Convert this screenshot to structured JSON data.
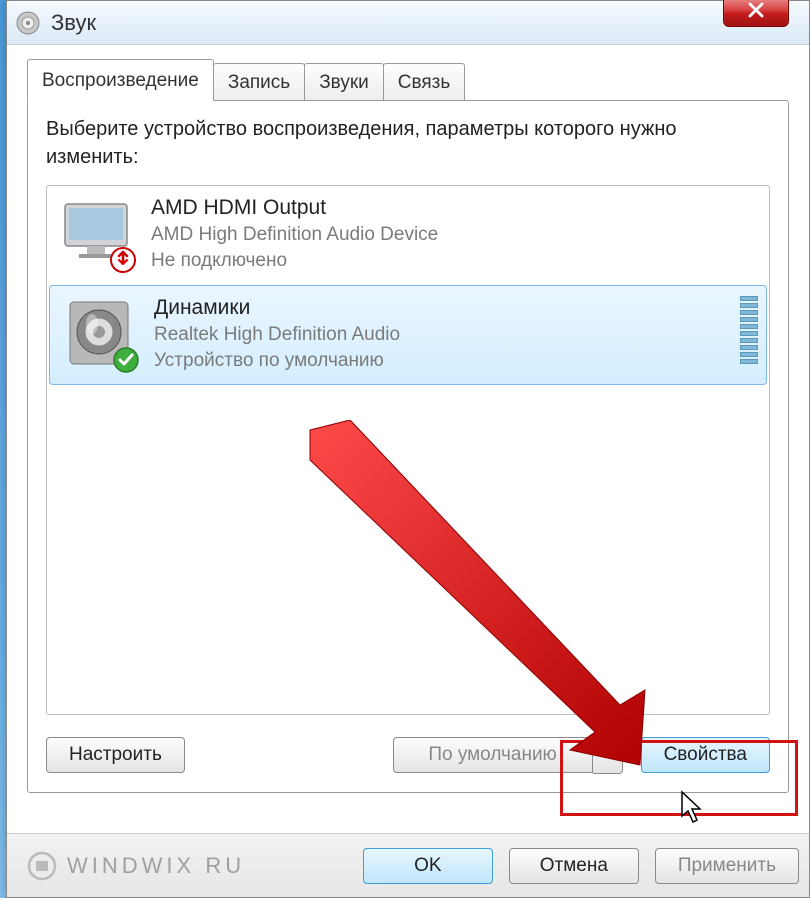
{
  "window": {
    "title": "Звук"
  },
  "tabs": [
    {
      "label": "Воспроизведение",
      "active": true
    },
    {
      "label": "Запись",
      "active": false
    },
    {
      "label": "Звуки",
      "active": false
    },
    {
      "label": "Связь",
      "active": false
    }
  ],
  "instruction": "Выберите устройство воспроизведения, параметры которого нужно изменить:",
  "devices": [
    {
      "name": "AMD HDMI Output",
      "driver": "AMD High Definition Audio Device",
      "status": "Не подключено",
      "selected": false,
      "icon": "monitor",
      "badge": "unplugged"
    },
    {
      "name": "Динамики",
      "driver": "Realtek High Definition Audio",
      "status": "Устройство по умолчанию",
      "selected": true,
      "icon": "speaker",
      "badge": "default"
    }
  ],
  "buttons": {
    "configure": "Настроить",
    "set_default": "По умолчанию",
    "properties": "Свойства",
    "ok": "OK",
    "cancel": "Отмена",
    "apply": "Применить"
  },
  "watermark": "WINDWIX RU"
}
